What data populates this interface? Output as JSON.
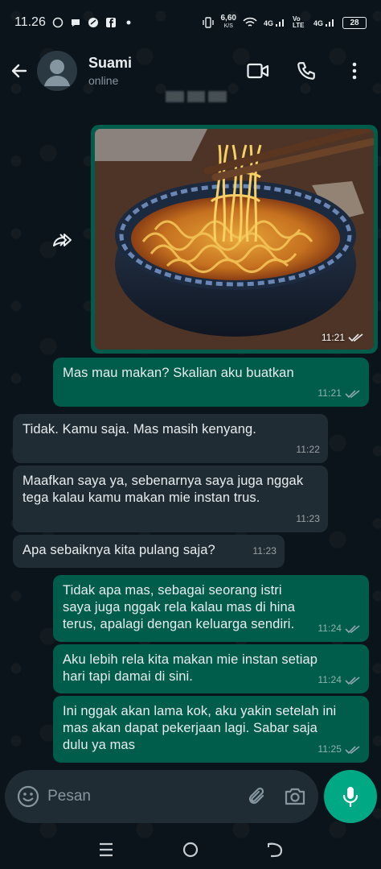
{
  "status_bar": {
    "time": "11.26",
    "speed_value": "6,60",
    "speed_unit": "K/S",
    "network1": "4G",
    "volte": "Vo LTE",
    "network2": "4G",
    "battery": "28"
  },
  "header": {
    "contact_name": "Suami",
    "contact_status": "online"
  },
  "messages": [
    {
      "text": "Mas mau makan? Skalian aku buatkan",
      "time": "11:21",
      "direction": "outgoing"
    },
    {
      "text": "Tidak. Kamu saja. Mas masih kenyang.",
      "time": "11:22",
      "direction": "incoming"
    },
    {
      "text": "Maafkan saya ya, sebenarnya saya juga nggak tega kalau kamu makan mie instan trus.",
      "time": "11:23",
      "direction": "incoming"
    },
    {
      "text": "Apa sebaiknya kita pulang saja?",
      "time": "11:23",
      "direction": "incoming"
    },
    {
      "text": "Tidak apa mas, sebagai seorang istri saya juga nggak rela kalau mas di hina terus, apalagi dengan keluarga sendiri.",
      "time": "11:24",
      "direction": "outgoing"
    },
    {
      "text": "Aku lebih rela kita makan mie instan setiap hari tapi damai di sini.",
      "time": "11:24",
      "direction": "outgoing"
    },
    {
      "text": "Ini nggak akan lama kok, aku yakin setelah ini mas akan dapat pekerjaan lagi. Sabar saja dulu ya mas",
      "time": "11:25",
      "direction": "outgoing"
    }
  ],
  "image_message": {
    "time": "11:21",
    "image_subject": "noodles-bowl"
  },
  "input": {
    "placeholder": "Pesan"
  },
  "colors": {
    "background": "#0b141a",
    "outgoing_bubble": "#005c4b",
    "incoming_bubble": "#202c33",
    "accent": "#00a884"
  }
}
